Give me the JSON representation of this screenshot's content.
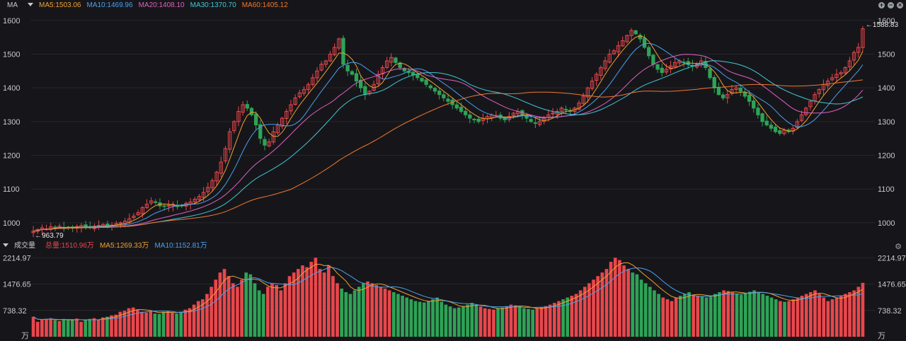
{
  "header": {
    "ma_label": "MA",
    "ma_values": [
      {
        "text": "MA5:1503.06",
        "color": "#f0a030"
      },
      {
        "text": "MA10:1469.96",
        "color": "#4aa0f0"
      },
      {
        "text": "MA20:1408.10",
        "color": "#e060c0"
      },
      {
        "text": "MA30:1370.70",
        "color": "#40c8d8"
      },
      {
        "text": "MA60:1405.12",
        "color": "#f07830"
      }
    ],
    "controls": [
      "plus-icon",
      "minus-icon",
      "close-icon"
    ]
  },
  "volume_header": {
    "title": "成交量",
    "items": [
      {
        "text": "总量:1510.96万",
        "color": "#e8474c"
      },
      {
        "text": "MA5:1269.33万",
        "color": "#f0a030"
      },
      {
        "text": "MA10:1152.81万",
        "color": "#4aa0f0"
      }
    ]
  },
  "chart_data": [
    {
      "type": "candlestick",
      "title": "",
      "y_ticks": [
        1000,
        1100,
        1200,
        1300,
        1400,
        1500,
        1600
      ],
      "ylim": [
        960,
        1610
      ],
      "annotations": {
        "high": "←1588.83",
        "low": "←963.79"
      },
      "colors": {
        "up": "#e8474c",
        "down": "#2ea356",
        "MA5": "#f0a030",
        "MA10": "#4aa0f0",
        "MA20": "#e060c0",
        "MA30": "#40c8d8",
        "MA60": "#f07830"
      },
      "close": [
        975,
        980,
        985,
        982,
        988,
        986,
        990,
        984,
        987,
        985,
        989,
        992,
        988,
        986,
        990,
        992,
        995,
        990,
        993,
        998,
        1000,
        1005,
        1012,
        1020,
        1030,
        1045,
        1055,
        1065,
        1060,
        1050,
        1048,
        1052,
        1055,
        1048,
        1050,
        1058,
        1062,
        1070,
        1078,
        1090,
        1105,
        1125,
        1150,
        1180,
        1220,
        1270,
        1300,
        1330,
        1350,
        1340,
        1320,
        1290,
        1250,
        1230,
        1240,
        1270,
        1290,
        1310,
        1330,
        1350,
        1370,
        1385,
        1395,
        1410,
        1430,
        1450,
        1470,
        1480,
        1500,
        1520,
        1545,
        1470,
        1450,
        1440,
        1420,
        1400,
        1380,
        1390,
        1410,
        1440,
        1460,
        1480,
        1490,
        1475,
        1460,
        1450,
        1445,
        1438,
        1430,
        1420,
        1410,
        1400,
        1390,
        1380,
        1370,
        1360,
        1350,
        1340,
        1330,
        1320,
        1310,
        1305,
        1300,
        1310,
        1315,
        1320,
        1318,
        1310,
        1305,
        1315,
        1325,
        1330,
        1320,
        1310,
        1300,
        1295,
        1300,
        1310,
        1320,
        1325,
        1330,
        1340,
        1335,
        1330,
        1340,
        1355,
        1375,
        1400,
        1420,
        1440,
        1460,
        1480,
        1500,
        1510,
        1525,
        1540,
        1555,
        1570,
        1560,
        1545,
        1520,
        1495,
        1470,
        1455,
        1445,
        1455,
        1465,
        1475,
        1480,
        1475,
        1470,
        1465,
        1470,
        1480,
        1460,
        1430,
        1400,
        1380,
        1370,
        1380,
        1395,
        1400,
        1390,
        1375,
        1360,
        1340,
        1320,
        1300,
        1290,
        1280,
        1270,
        1265,
        1275,
        1270,
        1280,
        1300,
        1320,
        1340,
        1360,
        1380,
        1395,
        1410,
        1420,
        1430,
        1440,
        1445,
        1460,
        1480,
        1505,
        1520,
        1575
      ]
    },
    {
      "type": "bar",
      "title": "",
      "unit": "万",
      "y_ticks": [
        738.32,
        1476.65,
        2214.97
      ],
      "ylim": [
        0,
        2300
      ],
      "colors": {
        "up": "#e8474c",
        "down": "#2ea356",
        "MA5": "#f0a030",
        "MA10": "#4aa0f0"
      },
      "values": [
        560,
        420,
        480,
        500,
        520,
        460,
        440,
        500,
        470,
        480,
        510,
        420,
        460,
        500,
        520,
        480,
        540,
        560,
        600,
        620,
        700,
        730,
        800,
        820,
        760,
        700,
        680,
        720,
        650,
        640,
        700,
        720,
        680,
        650,
        700,
        760,
        800,
        900,
        1000,
        1050,
        1200,
        1400,
        1600,
        1800,
        1900,
        1700,
        1500,
        1400,
        1600,
        1800,
        1750,
        1500,
        1300,
        1200,
        1400,
        1500,
        1450,
        1300,
        1500,
        1700,
        1800,
        1900,
        2000,
        1950,
        2100,
        2214,
        1900,
        1800,
        2000,
        1700,
        1500,
        1350,
        1250,
        1200,
        1300,
        1400,
        1500,
        1550,
        1500,
        1450,
        1400,
        1350,
        1300,
        1250,
        1200,
        1150,
        1100,
        1050,
        1000,
        980,
        960,
        1000,
        1050,
        1100,
        980,
        900,
        850,
        800,
        820,
        860,
        900,
        950,
        880,
        850,
        800,
        780,
        760,
        800,
        820,
        860,
        900,
        880,
        850,
        800,
        780,
        760,
        800,
        830,
        860,
        900,
        950,
        1000,
        1050,
        1100,
        1150,
        1200,
        1300,
        1400,
        1500,
        1600,
        1700,
        1800,
        1900,
        2100,
        2214,
        2150,
        2000,
        1900,
        1800,
        1750,
        1600,
        1500,
        1400,
        1300,
        1200,
        1100,
        1050,
        1000,
        1100,
        1150,
        1200,
        1250,
        1180,
        1150,
        1120,
        1100,
        1160,
        1200,
        1250,
        1300,
        1280,
        1240,
        1200,
        1180,
        1220,
        1260,
        1300,
        1250,
        1200,
        1150,
        1100,
        1050,
        1000,
        980,
        1000,
        1050,
        1100,
        1150,
        1200,
        1250,
        1300,
        1200,
        1100,
        1000,
        1050,
        1100,
        1150,
        1200,
        1250,
        1300,
        1400,
        1510.96
      ]
    }
  ]
}
